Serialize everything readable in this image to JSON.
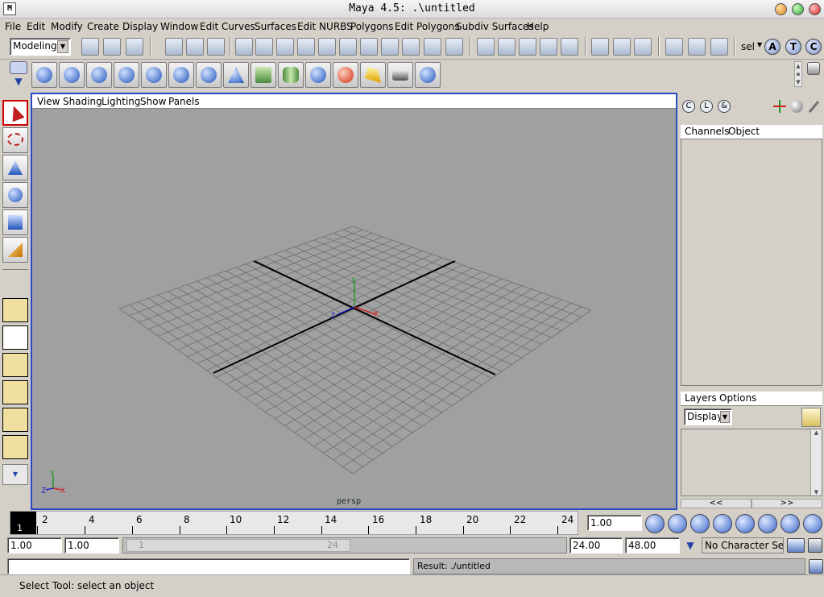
{
  "window": {
    "title": "Maya 4.5: .\\untitled",
    "app_icon": "M"
  },
  "menus": [
    "File",
    "Edit",
    "Modify",
    "Create",
    "Display",
    "Window",
    "Edit Curves",
    "Surfaces",
    "Edit NURBS",
    "Polygons",
    "Edit Polygons",
    "Subdiv Surfaces",
    "Help"
  ],
  "status_line": {
    "menu_set": "Modeling",
    "sel_label": "sel",
    "abc_buttons": [
      "A",
      "T",
      "C"
    ]
  },
  "viewport": {
    "panel_menus": [
      "View",
      "Shading",
      "Lighting",
      "Show",
      "Panels"
    ],
    "camera_label": "persp",
    "axis_labels": {
      "x": "X",
      "y": "Y",
      "z": "Z"
    },
    "grid_color": "#6e6e6e",
    "bg_color": "#a0a0a0"
  },
  "channel_box": {
    "icons": [
      "C",
      "L",
      "&"
    ],
    "tabs": [
      "Channels",
      "Object"
    ]
  },
  "layers": {
    "tabs": [
      "Layers",
      "Options"
    ],
    "dropdown_value": "Display",
    "nav_prev": "<<",
    "nav_next": ">>"
  },
  "timeline": {
    "current_frame": "1",
    "ticks": [
      "2",
      "4",
      "6",
      "8",
      "10",
      "12",
      "14",
      "16",
      "18",
      "20",
      "22",
      "24"
    ],
    "current_time_field": "1.00"
  },
  "range": {
    "start_time": "1.00",
    "playback_start": "1.00",
    "slider_start": "1",
    "slider_end": "24",
    "playback_end": "24.00",
    "end_time": "48.00",
    "character_set": "No Character Set"
  },
  "command": {
    "input_value": "",
    "result_text": "Result: ./untitled"
  },
  "help_line": "Select Tool: select an object"
}
